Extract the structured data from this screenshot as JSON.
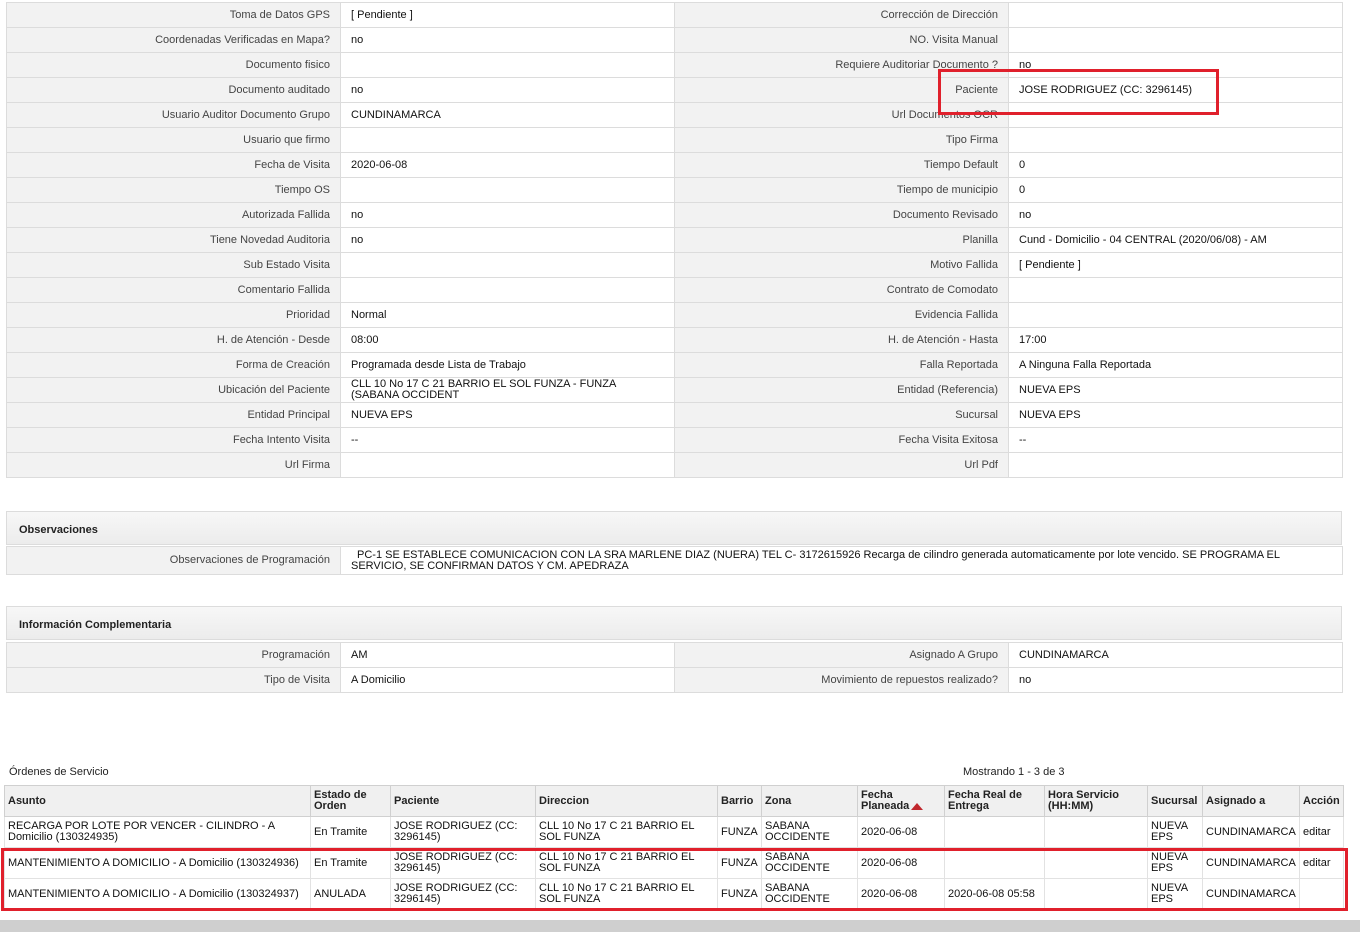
{
  "details": {
    "rows": [
      {
        "l1": "Toma de Datos GPS",
        "v1": "[ Pendiente ]",
        "l2": "Corrección de Dirección",
        "v2": ""
      },
      {
        "l1": "Coordenadas Verificadas en Mapa?",
        "v1": "no",
        "l2": "NO. Visita Manual",
        "v2": ""
      },
      {
        "l1": "Documento fisico",
        "v1": "",
        "l2": "Requiere Auditoriar Documento ?",
        "v2": "no"
      },
      {
        "l1": "Documento auditado",
        "v1": "no",
        "l2": "Paciente",
        "v2": "JOSE RODRIGUEZ (CC: 3296145)"
      },
      {
        "l1": "Usuario Auditor Documento Grupo",
        "v1": "CUNDINAMARCA",
        "l2": "Url Documentos OCR",
        "v2": ""
      },
      {
        "l1": "Usuario que firmo",
        "v1": "",
        "l2": "Tipo Firma",
        "v2": ""
      },
      {
        "l1": "Fecha de Visita",
        "v1": "2020-06-08",
        "l2": "Tiempo Default",
        "v2": "0"
      },
      {
        "l1": "Tiempo OS",
        "v1": "",
        "l2": "Tiempo de municipio",
        "v2": "0"
      },
      {
        "l1": "Autorizada Fallida",
        "v1": "no",
        "l2": "Documento Revisado",
        "v2": "no"
      },
      {
        "l1": "Tiene Novedad Auditoria",
        "v1": "no",
        "l2": "Planilla",
        "v2": "Cund - Domicilio - 04 CENTRAL (2020/06/08) - AM"
      },
      {
        "l1": "Sub Estado Visita",
        "v1": "",
        "l2": "Motivo Fallida",
        "v2": "[ Pendiente ]"
      },
      {
        "l1": "Comentario Fallida",
        "v1": "",
        "l2": "Contrato de Comodato",
        "v2": ""
      },
      {
        "l1": "Prioridad",
        "v1": "Normal",
        "l2": "Evidencia Fallida",
        "v2": ""
      },
      {
        "l1": "H. de Atención - Desde",
        "v1": "08:00",
        "l2": "H. de Atención - Hasta",
        "v2": "17:00"
      },
      {
        "l1": "Forma de Creación",
        "v1": "Programada desde Lista de Trabajo",
        "l2": "Falla Reportada",
        "v2": "A Ninguna Falla Reportada"
      },
      {
        "l1": "Ubicación del Paciente",
        "v1": "CLL 10 No 17 C 21 BARRIO EL SOL FUNZA - FUNZA (SABANA OCCIDENT",
        "l2": "Entidad (Referencia)",
        "v2": "NUEVA EPS"
      },
      {
        "l1": "Entidad Principal",
        "v1": "NUEVA EPS",
        "l2": "Sucursal",
        "v2": "NUEVA EPS"
      },
      {
        "l1": "Fecha Intento Visita",
        "v1": "--",
        "l2": "Fecha Visita Exitosa",
        "v2": "--"
      },
      {
        "l1": "Url Firma",
        "v1": "",
        "l2": "Url Pdf",
        "v2": ""
      }
    ]
  },
  "observaciones": {
    "title": "Observaciones",
    "label": "Observaciones de Programación",
    "value": "PC-1 SE ESTABLECE COMUNICACION CON LA SRA MARLENE DIAZ (NUERA) TEL C- 3172615926 Recarga de cilindro generada automaticamente por lote vencido. SE PROGRAMA EL SERVICIO, SE CONFIRMAN DATOS Y CM. APEDRAZA"
  },
  "complementaria": {
    "title": "Información Complementaria",
    "rows": [
      {
        "l1": "Programación",
        "v1": "AM",
        "l2": "Asignado A Grupo",
        "v2": "CUNDINAMARCA"
      },
      {
        "l1": "Tipo de Visita",
        "v1": "A Domicilio",
        "l2": "Movimiento de repuestos realizado?",
        "v2": "no"
      }
    ]
  },
  "ordenes": {
    "title": "Órdenes de Servicio",
    "showing": "Mostrando 1 - 3 de 3",
    "headers": {
      "asunto": "Asunto",
      "estado": "Estado de Orden",
      "paciente": "Paciente",
      "direccion": "Direccion",
      "barrio": "Barrio",
      "zona": "Zona",
      "fecha_planeada": "Fecha Planeada",
      "fecha_real": "Fecha Real de Entrega",
      "hora": "Hora Servicio (HH:MM)",
      "sucursal": "Sucursal",
      "asignado": "Asignado a",
      "accion": "Acción"
    },
    "rows": [
      {
        "asunto": "RECARGA POR LOTE POR VENCER - CILINDRO - A Domicilio (130324935)",
        "estado": "En Tramite",
        "paciente": "JOSE RODRIGUEZ (CC: 3296145)",
        "direccion": "CLL 10 No 17 C 21 BARRIO EL SOL FUNZA",
        "barrio": "FUNZA",
        "zona": "SABANA OCCIDENTE",
        "fecha_planeada": "2020-06-08",
        "fecha_real": "",
        "hora": "",
        "sucursal": "NUEVA EPS",
        "asignado": "CUNDINAMARCA",
        "accion": "editar"
      },
      {
        "asunto": "MANTENIMIENTO A DOMICILIO - A Domicilio (130324936)",
        "estado": "En Tramite",
        "paciente": "JOSE RODRIGUEZ (CC: 3296145)",
        "direccion": "CLL 10 No 17 C 21 BARRIO EL SOL FUNZA",
        "barrio": "FUNZA",
        "zona": "SABANA OCCIDENTE",
        "fecha_planeada": "2020-06-08",
        "fecha_real": "",
        "hora": "",
        "sucursal": "NUEVA EPS",
        "asignado": "CUNDINAMARCA",
        "accion": "editar"
      },
      {
        "asunto": "MANTENIMIENTO A DOMICILIO - A Domicilio (130324937)",
        "estado": "ANULADA",
        "paciente": "JOSE RODRIGUEZ (CC: 3296145)",
        "direccion": "CLL 10 No 17 C 21 BARRIO EL SOL FUNZA",
        "barrio": "FUNZA",
        "zona": "SABANA OCCIDENTE",
        "fecha_planeada": "2020-06-08",
        "fecha_real": "2020-06-08 05:58",
        "hora": "",
        "sucursal": "NUEVA EPS",
        "asignado": "CUNDINAMARCA",
        "accion": ""
      }
    ]
  },
  "colors": {
    "highlight": "#e0202c",
    "sort_arrow": "#c0272d"
  }
}
